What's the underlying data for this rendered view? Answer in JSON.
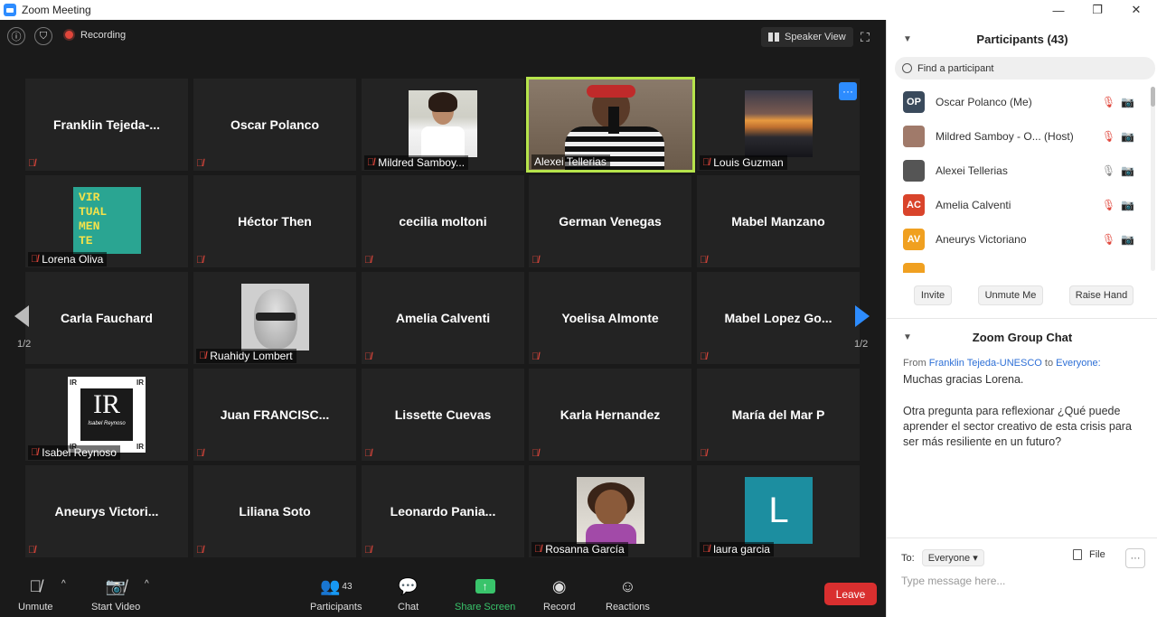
{
  "window": {
    "title": "Zoom Meeting",
    "controls": {
      "minimize": "—",
      "restore": "❐",
      "close": "✕"
    }
  },
  "topbar": {
    "info_icon": "ⓘ",
    "shield_icon": "⛉",
    "recording_label": "Recording",
    "speaker_view_label": "Speaker View",
    "fullscreen_icon": "⛶"
  },
  "gallery": {
    "page_left": "1/2",
    "page_right": "1/2",
    "more_icon": "···",
    "tiles": [
      {
        "name": "Franklin  Tejeda-...",
        "style": "big"
      },
      {
        "name": "Oscar Polanco",
        "style": "big"
      },
      {
        "name": "Mildred Samboy...",
        "style": "label"
      },
      {
        "name": "Alexei Tellerias",
        "style": "label",
        "active": true
      },
      {
        "name": "Louis Guzman",
        "style": "label"
      },
      {
        "name": "Lorena Oliva",
        "style": "label"
      },
      {
        "name": "Héctor Then",
        "style": "big"
      },
      {
        "name": "cecilia moltoni",
        "style": "big"
      },
      {
        "name": "German Venegas",
        "style": "big"
      },
      {
        "name": "Mabel Manzano",
        "style": "big"
      },
      {
        "name": "Carla Fauchard",
        "style": "big"
      },
      {
        "name": "Ruahidy Lombert",
        "style": "label"
      },
      {
        "name": "Amelia Calventi",
        "style": "big"
      },
      {
        "name": "Yoelisa Almonte",
        "style": "big"
      },
      {
        "name": "Mabel  Lopez  Go...",
        "style": "big"
      },
      {
        "name": "Isabel Reynoso",
        "style": "label"
      },
      {
        "name": "Juan  FRANCISC...",
        "style": "big"
      },
      {
        "name": "Lissette Cuevas",
        "style": "big"
      },
      {
        "name": "Karla Hernandez",
        "style": "big"
      },
      {
        "name": "María del Mar P",
        "style": "big"
      },
      {
        "name": "Aneurys  Victori...",
        "style": "big"
      },
      {
        "name": "Liliana Soto",
        "style": "big"
      },
      {
        "name": "Leonardo  Pania...",
        "style": "big"
      },
      {
        "name": "Rosanna García",
        "style": "label"
      },
      {
        "name": "laura garcia",
        "style": "label"
      }
    ],
    "virtual_tile_text": [
      "VIR",
      "TUAL",
      "MEN",
      "TE"
    ],
    "ir_logo_text": "IR",
    "ir_logo_sub": "Isabel Reynoso",
    "ir_border_text": "IR",
    "laura_initial": "L"
  },
  "toolbar": {
    "unmute": "Unmute",
    "start_video": "Start Video",
    "participants": "Participants",
    "participants_count": "43",
    "chat": "Chat",
    "share_screen": "Share Screen",
    "record": "Record",
    "reactions": "Reactions",
    "leave": "Leave",
    "caret": "^"
  },
  "participants_panel": {
    "title": "Participants (43)",
    "search_placeholder": "Find a participant",
    "rows": [
      {
        "initials": "OP",
        "color": "#3a4a5c",
        "name": "Oscar Polanco (Me)"
      },
      {
        "initials": "",
        "color": "#a07a6a",
        "name": "Mildred Samboy - O...  (Host)"
      },
      {
        "initials": "",
        "color": "#555555",
        "name": "Alexei Tellerias"
      },
      {
        "initials": "AC",
        "color": "#d9442b",
        "name": "Amelia Calventi"
      },
      {
        "initials": "AV",
        "color": "#f0a020",
        "name": "Aneurys Victoriano"
      }
    ],
    "invite": "Invite",
    "unmute_me": "Unmute Me",
    "raise_hand": "Raise Hand",
    "status_muted_icons": "🎙📷"
  },
  "chat_panel": {
    "title": "Zoom Group Chat",
    "from_prefix": "From",
    "from_name": "Franklin Tejeda-UNESCO",
    "to_word": "to",
    "to_name": "Everyone:",
    "message_1": "Muchas gracias Lorena.",
    "message_2": "Otra pregunta para reflexionar ¿Qué puede aprender el sector creativo de esta crisis para ser más resiliente en un futuro?",
    "to_label": "To:",
    "to_select": "Everyone",
    "file_label": "File",
    "more": "···",
    "input_placeholder": "Type message here..."
  },
  "colors": {
    "accent": "#2d8cff",
    "mute_red": "#e0463b",
    "active_border": "#b6e44b",
    "share_green": "#39c46b",
    "leave_red": "#d92f2f"
  }
}
